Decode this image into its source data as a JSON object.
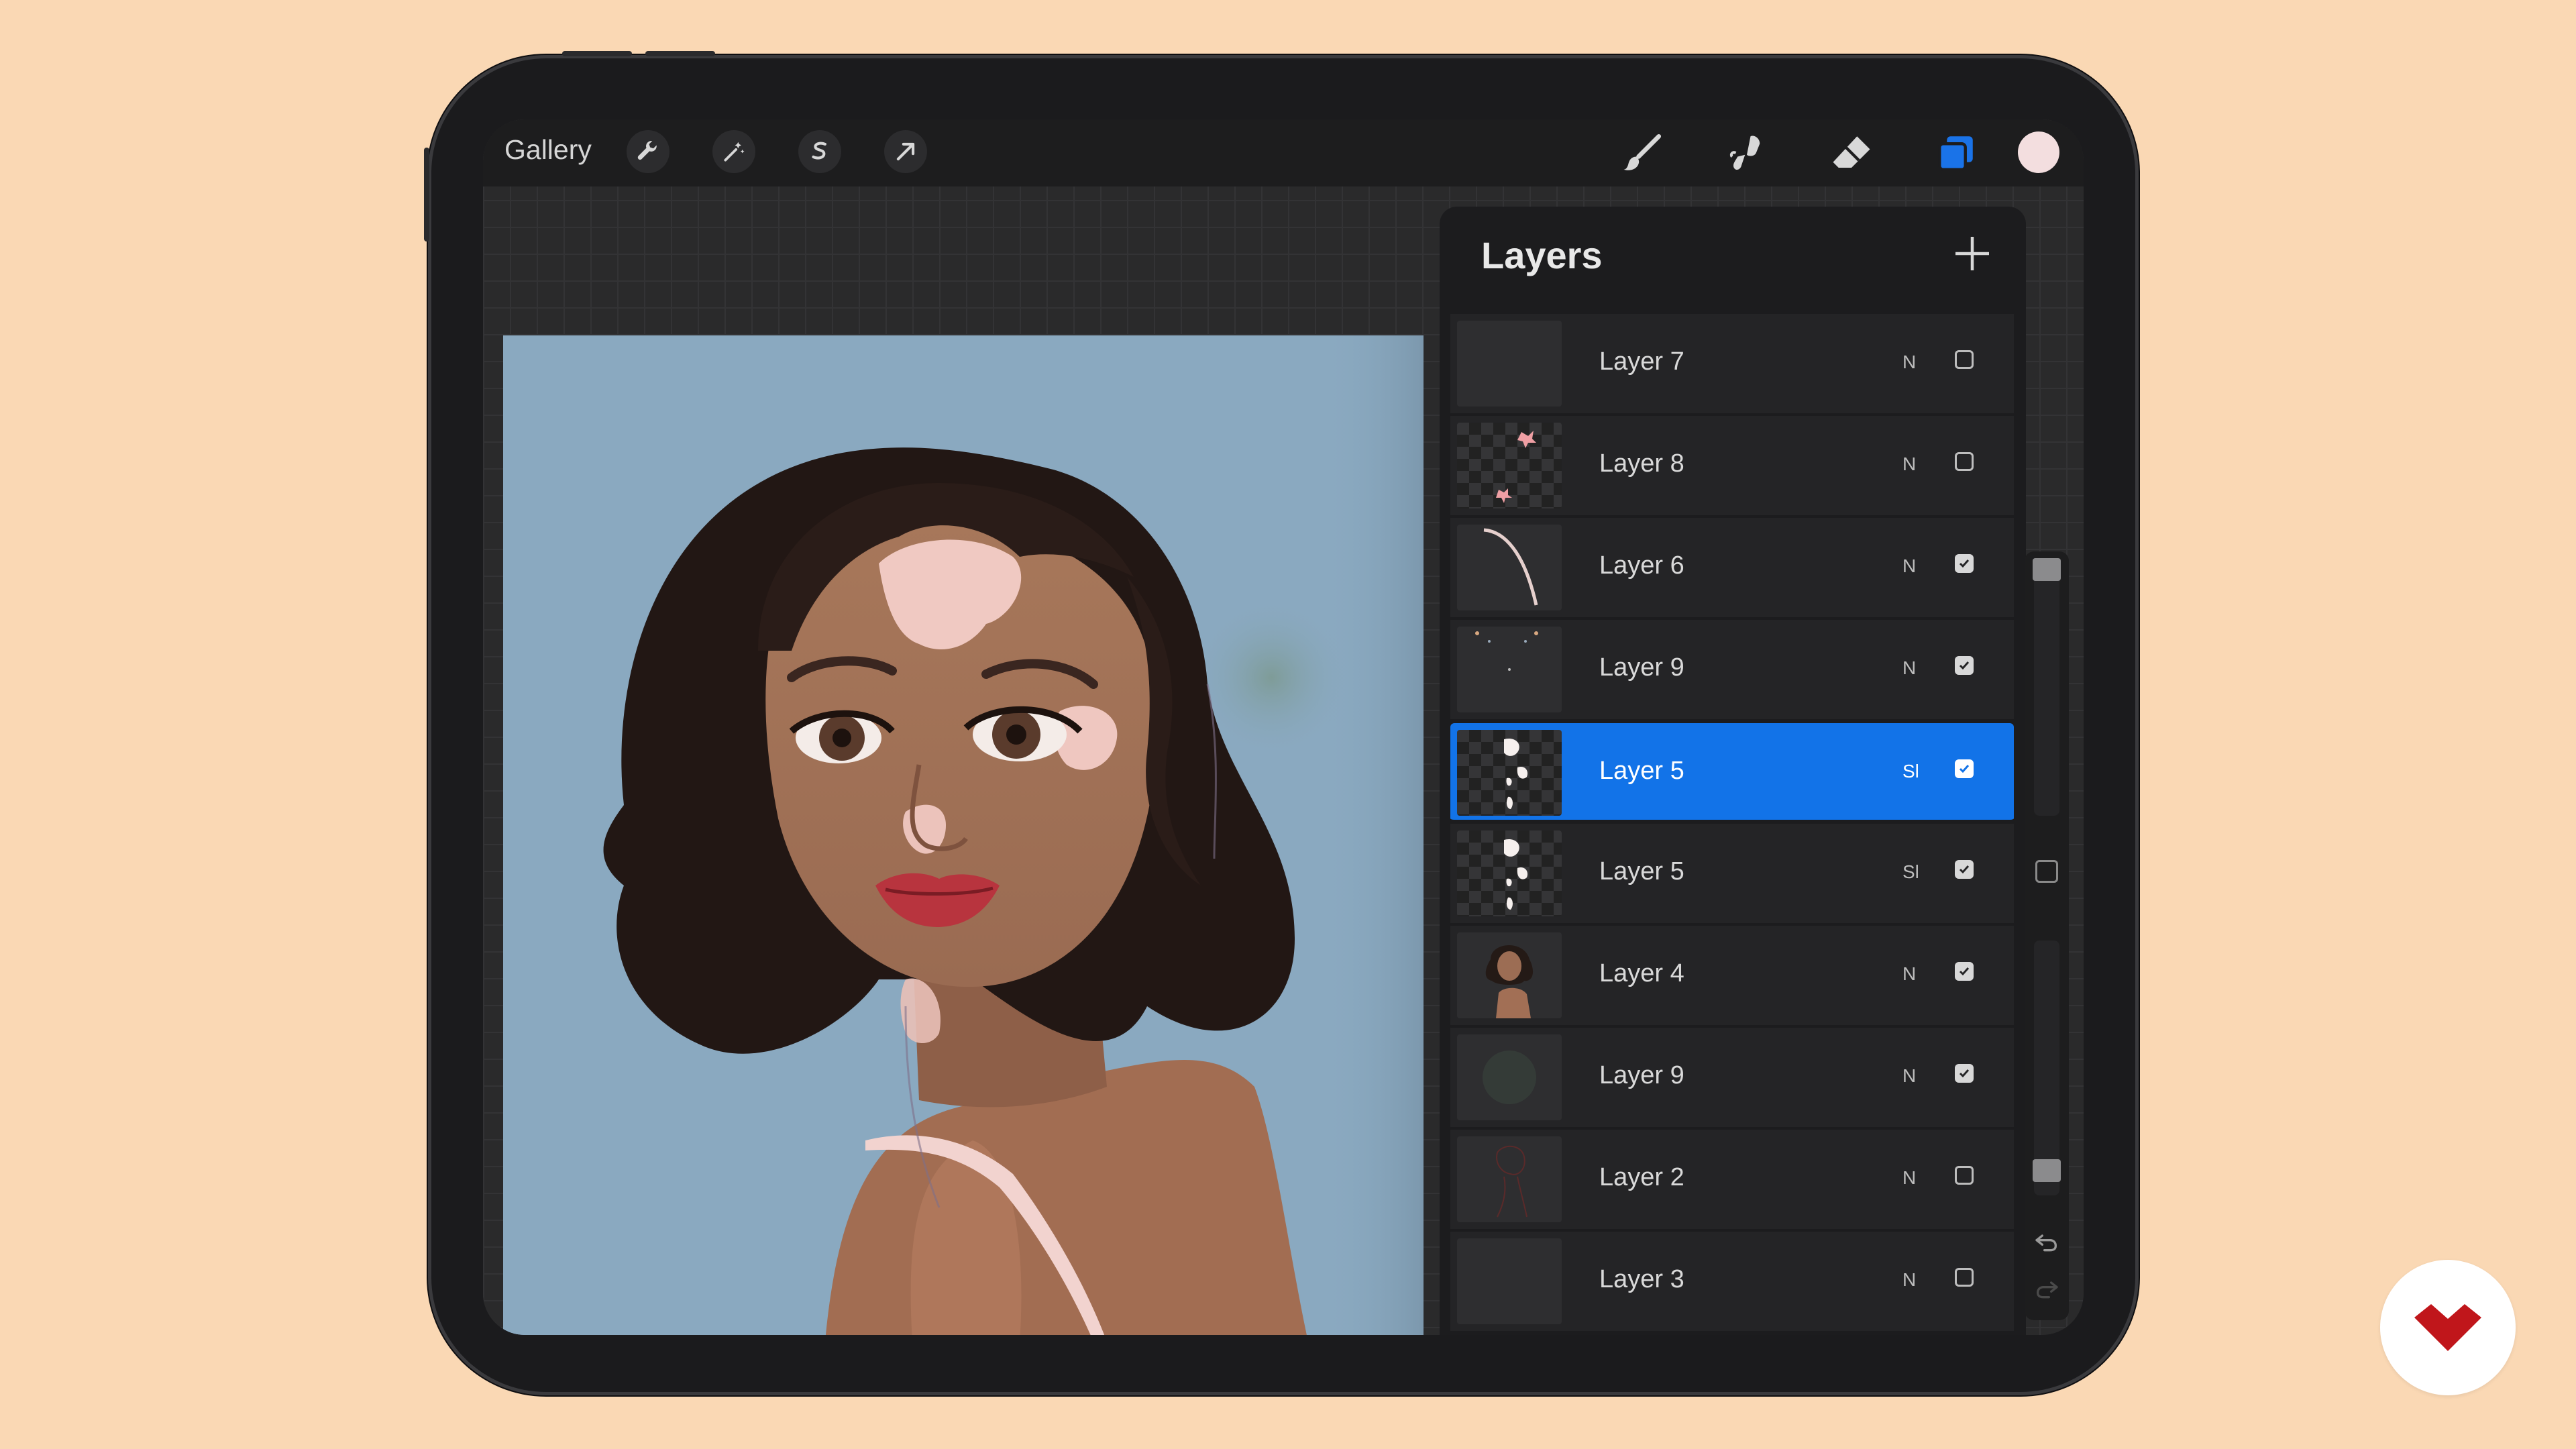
{
  "toolbar": {
    "gallery_label": "Gallery",
    "left_tools": [
      "wrench-icon",
      "magic-wand-icon",
      "selection-icon",
      "transform-arrow-icon"
    ],
    "right_tools": [
      "brush-icon",
      "smudge-icon",
      "eraser-icon",
      "layers-icon"
    ],
    "active_tool_color": "#1a73e8",
    "current_color": "#f3dedf"
  },
  "layers": {
    "title": "Layers",
    "add_icon": "plus-icon",
    "items": [
      {
        "name": "Layer 7",
        "mode": "N",
        "visible": false,
        "selected": false
      },
      {
        "name": "Layer 8",
        "mode": "N",
        "visible": false,
        "selected": false
      },
      {
        "name": "Layer 6",
        "mode": "N",
        "visible": true,
        "selected": false
      },
      {
        "name": "Layer 9",
        "mode": "N",
        "visible": true,
        "selected": false
      },
      {
        "name": "Layer 5",
        "mode": "Sl",
        "visible": true,
        "selected": true
      },
      {
        "name": "Layer 5",
        "mode": "Sl",
        "visible": true,
        "selected": false
      },
      {
        "name": "Layer 4",
        "mode": "N",
        "visible": true,
        "selected": false
      },
      {
        "name": "Layer 9",
        "mode": "N",
        "visible": true,
        "selected": false
      },
      {
        "name": "Layer 2",
        "mode": "N",
        "visible": false,
        "selected": false
      },
      {
        "name": "Layer 3",
        "mode": "N",
        "visible": false,
        "selected": false
      }
    ]
  },
  "sidebar": {
    "controls": [
      "brush-size-slider",
      "modify-button",
      "opacity-slider",
      "undo-icon",
      "redo-icon"
    ]
  },
  "colors": {
    "background": "#fad8b4",
    "selection": "#1273e8",
    "canvas_bg": "#8aa9c0"
  }
}
